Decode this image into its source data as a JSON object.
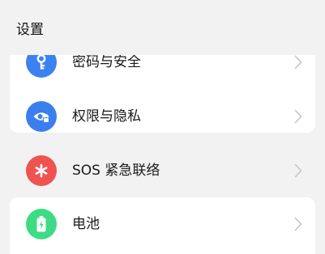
{
  "header": {
    "title": "设置"
  },
  "items": [
    {
      "label": "密码与安全",
      "icon": "key-icon",
      "color": "#3b82f0"
    },
    {
      "label": "权限与隐私",
      "icon": "eye-lock-icon",
      "color": "#3b7fef"
    },
    {
      "label": "SOS 紧急联络",
      "icon": "asterisk-icon",
      "color": "#ef5350"
    },
    {
      "label": "电池",
      "icon": "battery-icon",
      "color": "#3ddc84"
    }
  ],
  "colors": {
    "background": "#f2f2f2",
    "card": "#ffffff",
    "chevron": "#c4c4c4"
  }
}
